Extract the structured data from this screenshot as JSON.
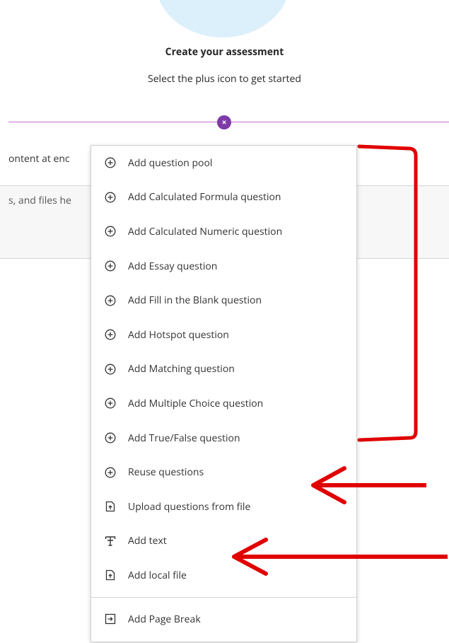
{
  "header": {
    "title": "Create your assessment",
    "subtitle": "Select the plus icon to get started"
  },
  "background": {
    "line1": "ontent at enc",
    "line2": "s, and files he"
  },
  "close_button": {
    "symbol": "×"
  },
  "menu": {
    "items": [
      {
        "label": "Add question pool",
        "icon": "plus-circle-icon"
      },
      {
        "label": "Add Calculated Formula question",
        "icon": "plus-circle-icon"
      },
      {
        "label": "Add Calculated Numeric question",
        "icon": "plus-circle-icon"
      },
      {
        "label": "Add Essay question",
        "icon": "plus-circle-icon"
      },
      {
        "label": "Add Fill in the Blank question",
        "icon": "plus-circle-icon"
      },
      {
        "label": "Add Hotspot question",
        "icon": "plus-circle-icon"
      },
      {
        "label": "Add Matching question",
        "icon": "plus-circle-icon"
      },
      {
        "label": "Add Multiple Choice question",
        "icon": "plus-circle-icon"
      },
      {
        "label": "Add True/False question",
        "icon": "plus-circle-icon"
      },
      {
        "label": "Reuse questions",
        "icon": "plus-circle-icon"
      },
      {
        "label": "Upload questions from file",
        "icon": "file-upload-icon"
      },
      {
        "label": "Add text",
        "icon": "text-icon"
      },
      {
        "label": "Add local file",
        "icon": "file-upload-icon"
      }
    ],
    "page_break": {
      "label": "Add Page Break",
      "icon": "page-break-icon"
    }
  },
  "colors": {
    "accent_purple": "#7e3aa6",
    "divider_purple": "#c56fd0",
    "annotation_red": "#e00000",
    "illustration_blue": "#dcf0fb"
  }
}
